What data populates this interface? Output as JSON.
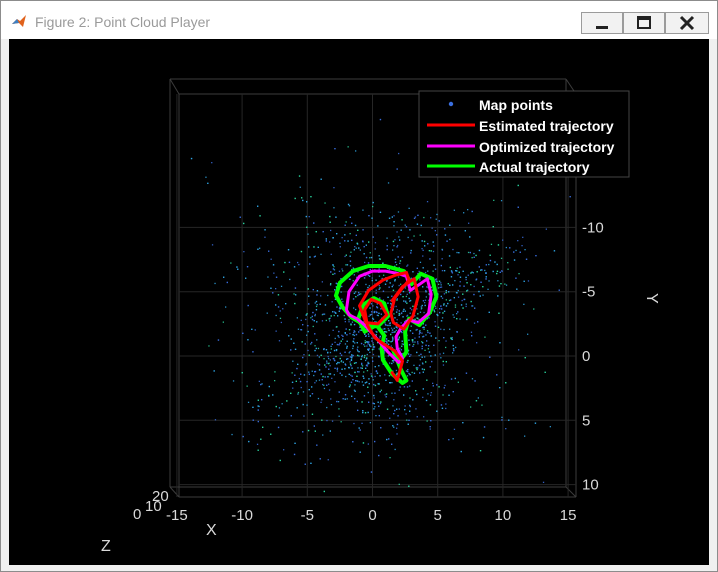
{
  "window": {
    "title": "Figure 2: Point Cloud Player"
  },
  "legend": {
    "entries": [
      {
        "label": "Map points",
        "color": "#3a6fe0",
        "marker": "dot"
      },
      {
        "label": "Estimated trajectory",
        "color": "#ff0000",
        "marker": "line"
      },
      {
        "label": "Optimized trajectory",
        "color": "#ff00ff",
        "marker": "line"
      },
      {
        "label": "Actual trajectory",
        "color": "#00ff00",
        "marker": "line"
      }
    ]
  },
  "axes": {
    "x": {
      "label": "X",
      "ticks": [
        "-15",
        "-10",
        "-5",
        "0",
        "5",
        "10",
        "15"
      ]
    },
    "y": {
      "label": "Y",
      "ticks": [
        "-10",
        "-5",
        "0",
        "5",
        "10"
      ]
    },
    "z": {
      "label": "Z",
      "ticks": [
        "20",
        "10",
        "0"
      ]
    }
  },
  "colors": {
    "background": "#000000",
    "axis_text": "#d9d9d9",
    "map_points_dark": "#3a6fe0",
    "map_points_light": "#2fa8e8",
    "map_points_green": "#2ad7a0"
  },
  "chart_data": {
    "type": "scatter",
    "title": "",
    "xlabel": "X",
    "ylabel": "Y",
    "zlabel": "Z",
    "xlim": [
      -16,
      16
    ],
    "ylim": [
      -16,
      11
    ],
    "y_direction": "reversed",
    "grid": true,
    "legend_position": "top-right",
    "series": [
      {
        "name": "Estimated trajectory",
        "color": "#ff0000",
        "x": [
          1.5,
          1.9,
          2.3,
          1.7,
          0.9,
          0.2,
          -0.4,
          -0.6,
          -0.1,
          0.6,
          1.1,
          0.4,
          -0.5,
          -1.0,
          -0.3,
          0.8,
          1.8,
          2.6,
          2.8,
          2.3,
          1.7,
          1.4,
          1.6,
          2.4,
          3.1,
          3.5,
          3.2,
          2.3,
          1.5
        ],
        "y": [
          1.3,
          1.9,
          0.4,
          -0.4,
          -0.9,
          -1.4,
          -2.4,
          -3.6,
          -4.4,
          -4.1,
          -3.2,
          -2.5,
          -2.6,
          -3.9,
          -5.1,
          -5.9,
          -6.3,
          -6.5,
          -5.9,
          -5.3,
          -4.5,
          -3.3,
          -2.6,
          -2.1,
          -3.1,
          -4.6,
          -6.0,
          -5.4,
          -4.3
        ]
      },
      {
        "name": "Optimized trajectory",
        "color": "#ff00ff",
        "x": [
          -2.0,
          -1.8,
          -1.0,
          0.0,
          1.0,
          2.0,
          2.6,
          2.9,
          3.5,
          4.2,
          4.5,
          4.3,
          3.5,
          2.8,
          2.2,
          1.8,
          1.9,
          2.3,
          2.0,
          1.2,
          0.2,
          -0.6,
          -1.2,
          -1.8,
          -2.0
        ],
        "y": [
          -3.6,
          -5.0,
          -6.2,
          -6.6,
          -6.6,
          -6.4,
          -6.2,
          -5.1,
          -5.5,
          -6.0,
          -4.8,
          -3.3,
          -2.6,
          -2.8,
          -2.2,
          -1.5,
          -0.6,
          0.2,
          0.5,
          -0.3,
          -1.5,
          -2.4,
          -2.9,
          -3.2,
          -3.6
        ]
      },
      {
        "name": "Actual trajectory",
        "color": "#00ff00",
        "x": [
          -2.8,
          -2.5,
          -1.5,
          -0.3,
          1.0,
          2.4,
          3.0,
          3.7,
          4.6,
          4.9,
          4.4,
          3.6,
          2.8,
          2.5,
          2.6,
          2.1,
          1.6,
          2.2,
          2.6,
          2.3,
          1.5,
          0.8,
          0.7,
          0.9,
          0.3,
          -0.6,
          -1.1,
          -0.7,
          0.1,
          0.9,
          1.2,
          0.4,
          -0.6,
          -1.6,
          -2.3,
          -2.8
        ],
        "y": [
          -4.7,
          -5.7,
          -6.6,
          -7.0,
          -7.0,
          -6.6,
          -5.6,
          -6.4,
          -6.0,
          -4.6,
          -3.4,
          -2.4,
          -2.9,
          -1.9,
          -0.3,
          0.4,
          -0.4,
          1.1,
          1.9,
          2.1,
          1.4,
          0.3,
          -0.6,
          -1.6,
          -2.4,
          -1.9,
          -2.9,
          -4.0,
          -4.5,
          -4.1,
          -3.1,
          -2.3,
          -2.4,
          -3.0,
          -3.8,
          -4.7
        ]
      }
    ]
  }
}
